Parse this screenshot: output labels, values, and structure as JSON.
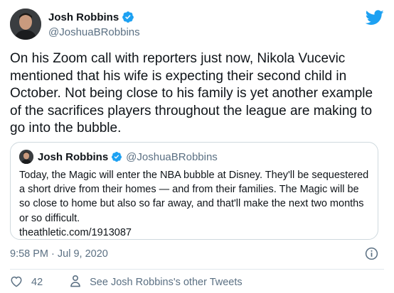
{
  "author": {
    "display_name": "Josh Robbins",
    "handle": "@JoshuaBRobbins"
  },
  "tweet": {
    "text": "On his Zoom call with reporters just now, Nikola Vucevic mentioned that his wife is expecting their second child in October. Not being close to his family is yet another example of the sacrifices players throughout the league are making to go into the bubble."
  },
  "quoted_tweet": {
    "display_name": "Josh Robbins",
    "handle": "@JoshuaBRobbins",
    "text": "Today, the Magic will enter the NBA bubble at Disney. They'll be sequestered a short drive from their homes — and from their families. The Magic will be so close to home but also so far away, and that'll make the next two months or so difficult.",
    "link": "theathletic.com/1913087"
  },
  "meta": {
    "timestamp": "9:58 PM · Jul 9, 2020"
  },
  "actions": {
    "like_count": "42",
    "see_others_label": "See Josh Robbins's other Tweets"
  },
  "colors": {
    "brand_blue": "#1da1f2",
    "secondary_text": "#5b7083",
    "border": "#cfd9de"
  },
  "icons": {
    "logo": "twitter-bird-icon",
    "verified": "verified-badge-icon",
    "info": "info-icon",
    "like": "heart-icon",
    "profile": "person-icon"
  }
}
